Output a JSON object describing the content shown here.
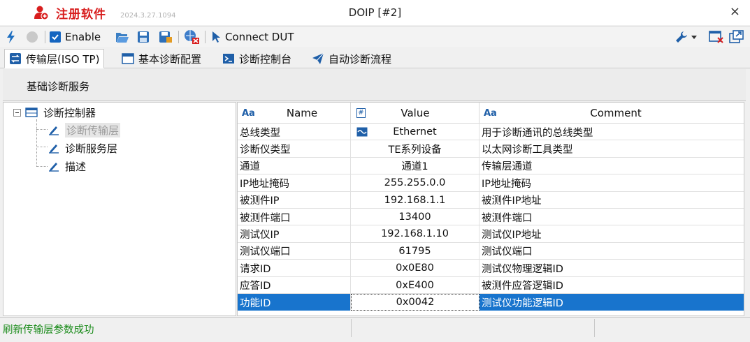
{
  "titlebar": {
    "app_name": "注册软件",
    "version": "2024.3.27.1094",
    "window_title": "DOIP [#2]",
    "close": "×"
  },
  "toolbar": {
    "enable_label": "Enable",
    "connect_label": "Connect DUT"
  },
  "tabs": [
    {
      "label": "传输层(ISO TP)",
      "active": true
    },
    {
      "label": "基本诊断配置",
      "active": false
    },
    {
      "label": "诊断控制台",
      "active": false
    },
    {
      "label": "自动诊断流程",
      "active": false
    }
  ],
  "sub_header": "基础诊断服务",
  "tree": {
    "root": "诊断控制器",
    "children": [
      "诊断传输层",
      "诊断服务层",
      "描述"
    ],
    "selected_index": 0
  },
  "grid": {
    "columns": [
      "Name",
      "Value",
      "Comment"
    ],
    "rows": [
      {
        "name": "总线类型",
        "value": "Ethernet",
        "comment": "用于诊断通讯的总线类型"
      },
      {
        "name": "诊断仪类型",
        "value": "TE系列设备",
        "comment": "以太网诊断工具类型"
      },
      {
        "name": "通道",
        "value": "通道1",
        "comment": "传输层通道"
      },
      {
        "name": "IP地址掩码",
        "value": "255.255.0.0",
        "comment": "IP地址掩码"
      },
      {
        "name": "被测件IP",
        "value": "192.168.1.1",
        "comment": "被测件IP地址"
      },
      {
        "name": "被测件端口",
        "value": "13400",
        "comment": "被测件端口"
      },
      {
        "name": "测试仪IP",
        "value": "192.168.1.10",
        "comment": "测试仪IP地址"
      },
      {
        "name": "测试仪端口",
        "value": "61795",
        "comment": "测试仪端口"
      },
      {
        "name": "请求ID",
        "value": "0x0E80",
        "comment": "测试仪物理逻辑ID"
      },
      {
        "name": "应答ID",
        "value": "0xE400",
        "comment": "被测件应答逻辑ID"
      },
      {
        "name": "功能ID",
        "value": "0x0042",
        "comment": "测试仪功能逻辑ID"
      }
    ],
    "selected_row": 10
  },
  "status": {
    "message": "刷新传输层参数成功"
  },
  "colors": {
    "accent": "#1874cd",
    "brand": "#d81e1e",
    "status_ok": "#188a18"
  }
}
